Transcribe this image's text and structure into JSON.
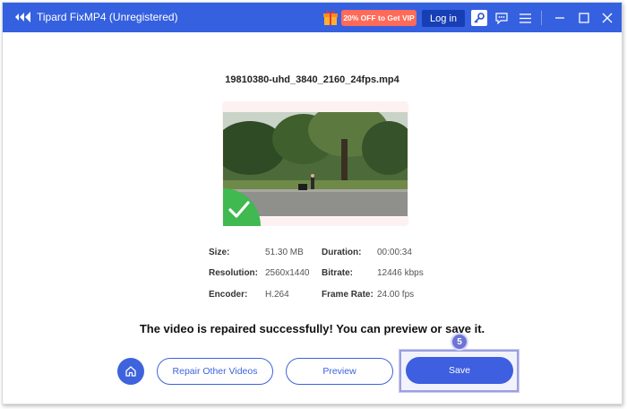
{
  "window": {
    "title": "Tipard FixMP4 (Unregistered)",
    "promo_label": "20% OFF to Get VIP",
    "login_label": "Log in"
  },
  "content": {
    "filename": "19810380-uhd_3840_2160_24fps.mp4",
    "info": [
      {
        "label": "Size:",
        "value": "51.30 MB"
      },
      {
        "label": "Duration:",
        "value": "00:00:34"
      },
      {
        "label": "Resolution:",
        "value": "2560x1440"
      },
      {
        "label": "Bitrate:",
        "value": "12446 kbps"
      },
      {
        "label": "Encoder:",
        "value": "H.264"
      },
      {
        "label": "Frame Rate:",
        "value": "24.00 fps"
      }
    ],
    "message": "The video is repaired successfully! You can preview or save it."
  },
  "actions": {
    "repair_other_label": "Repair Other Videos",
    "preview_label": "Preview",
    "save_label": "Save",
    "step_number": "5"
  },
  "colors": {
    "titlebar": "#3560e0",
    "accent": "#3e63dd",
    "promo": "#ff6a59",
    "success": "#3fb950"
  }
}
